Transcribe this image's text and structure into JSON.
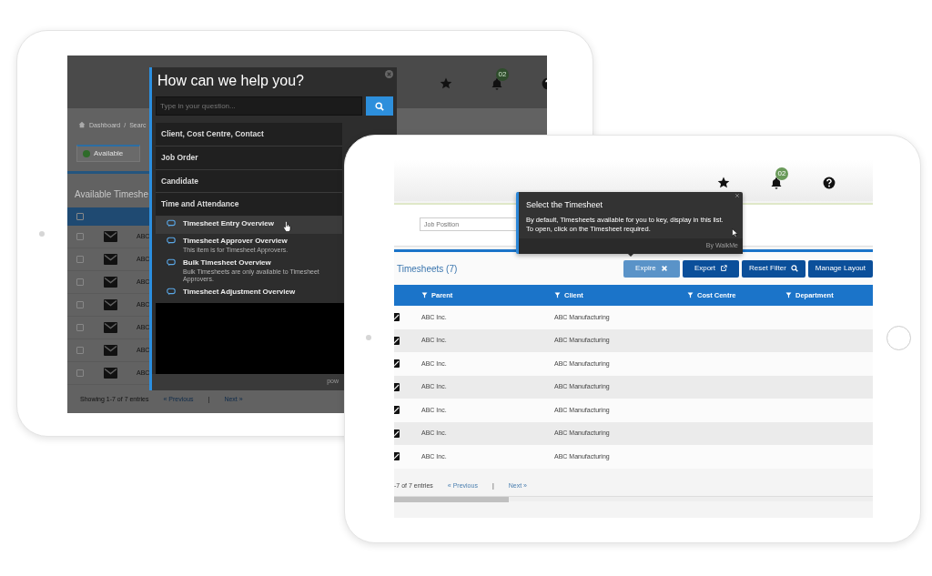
{
  "back_tablet": {
    "header": {
      "notification_count": "02"
    },
    "breadcrumb": [
      "Dashboard",
      "/",
      "Searc"
    ],
    "tab": {
      "label": "Available"
    },
    "section_title": "Available Timeshe",
    "select_all": {
      "checked": false
    },
    "rows": [
      {
        "cell": "ABC",
        "checked": false
      },
      {
        "cell": "ABC",
        "checked": false
      },
      {
        "cell": "ABC",
        "checked": false
      },
      {
        "cell": "ABC",
        "checked": false
      },
      {
        "cell": "ABC",
        "checked": false
      },
      {
        "cell": "ABC",
        "checked": false
      },
      {
        "cell": "ABC",
        "checked": false
      }
    ],
    "footer": {
      "summary": "Showing 1-7 of 7 entries",
      "previous": "« Previous",
      "separator": "|",
      "next": "Next »"
    },
    "help_panel": {
      "title": "How can we help you?",
      "search": {
        "placeholder": "Type in your question..."
      },
      "categories": [
        {
          "label": "Client, Cost Centre, Contact"
        },
        {
          "label": "Job Order"
        },
        {
          "label": "Candidate"
        },
        {
          "label": "Time and Attendance",
          "articles": [
            {
              "title": "Timesheet Entry Overview",
              "selected": true
            },
            {
              "title": "Timesheet Approver Overview",
              "note": "This item is for Timesheet Approvers.",
              "selected": false
            },
            {
              "title": "Bulk Timesheet Overview",
              "note": "Bulk Timesheets are only available to Timesheet Approvers.",
              "selected": false
            },
            {
              "title": "Timesheet Adjustment Overview",
              "selected": false
            }
          ]
        }
      ],
      "footer": "pow"
    }
  },
  "front_tablet": {
    "header": {
      "notification_count": "02"
    },
    "filter": {
      "placeholder": "Job Position"
    },
    "tooltip": {
      "title": "Select the Timesheet",
      "body": "By default, Timesheets available for you to key, display in this list. To open, click on the Timesheet required.",
      "footer": "By WalkMe"
    },
    "table_title": "Timesheets (7)",
    "buttons": [
      {
        "label": "Expire",
        "kind": "close",
        "disabled": true
      },
      {
        "label": "Export",
        "kind": "external",
        "disabled": false
      },
      {
        "label": "Reset Filter",
        "kind": "search",
        "disabled": false
      },
      {
        "label": "Manage Layout",
        "kind": "none",
        "disabled": false
      }
    ],
    "columns": [
      "Parent",
      "Client",
      "Cost Centre",
      "Department"
    ],
    "rows": [
      {
        "parent": "ABC Inc.",
        "client": "ABC Manufacturing"
      },
      {
        "parent": "ABC Inc.",
        "client": "ABC Manufacturing"
      },
      {
        "parent": "ABC Inc.",
        "client": "ABC Manufacturing"
      },
      {
        "parent": "ABC Inc.",
        "client": "ABC Manufacturing"
      },
      {
        "parent": "ABC Inc.",
        "client": "ABC Manufacturing"
      },
      {
        "parent": "ABC Inc.",
        "client": "ABC Manufacturing"
      },
      {
        "parent": "ABC Inc.",
        "client": "ABC Manufacturing"
      }
    ],
    "footer": {
      "summary": "-7 of 7 entries",
      "previous": "« Previous",
      "separator": "|",
      "next": "Next »"
    }
  }
}
